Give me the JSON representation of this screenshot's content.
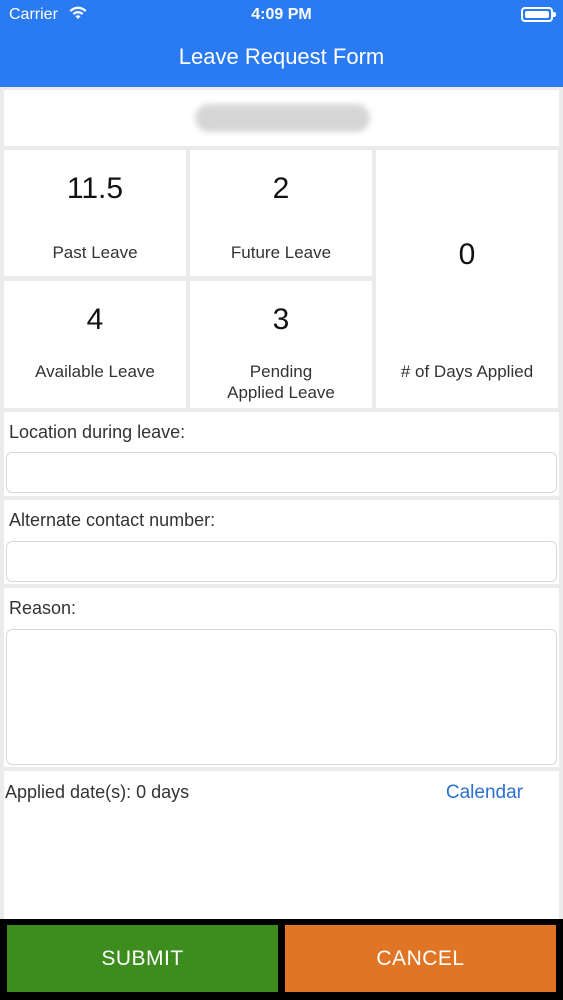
{
  "status_bar": {
    "carrier": "Carrier",
    "time": "4:09 PM"
  },
  "header": {
    "title": "Leave Request Form"
  },
  "stats": {
    "past_leave": {
      "value": "11.5",
      "label": "Past Leave"
    },
    "future_leave": {
      "value": "2",
      "label": "Future Leave"
    },
    "days_applied": {
      "value": "0",
      "label": "# of Days Applied"
    },
    "available_leave": {
      "value": "4",
      "label": "Available Leave"
    },
    "pending_leave": {
      "value": "3",
      "label_line1": "Pending",
      "label_line2": "Applied Leave"
    }
  },
  "form": {
    "location_label": "Location during leave:",
    "location_value": "",
    "contact_label": "Alternate contact number:",
    "contact_value": "",
    "reason_label": "Reason:",
    "reason_value": ""
  },
  "dates": {
    "applied_text": "Applied date(s): 0 days",
    "calendar_link": "Calendar"
  },
  "footer": {
    "submit_label": "SUBMIT",
    "cancel_label": "CANCEL"
  },
  "colors": {
    "header": "#2a7bf2",
    "submit": "#3c8c1e",
    "cancel": "#e07526",
    "link": "#2a70d0"
  },
  "icons": {
    "wifi": "wifi-icon",
    "battery": "battery-icon"
  }
}
